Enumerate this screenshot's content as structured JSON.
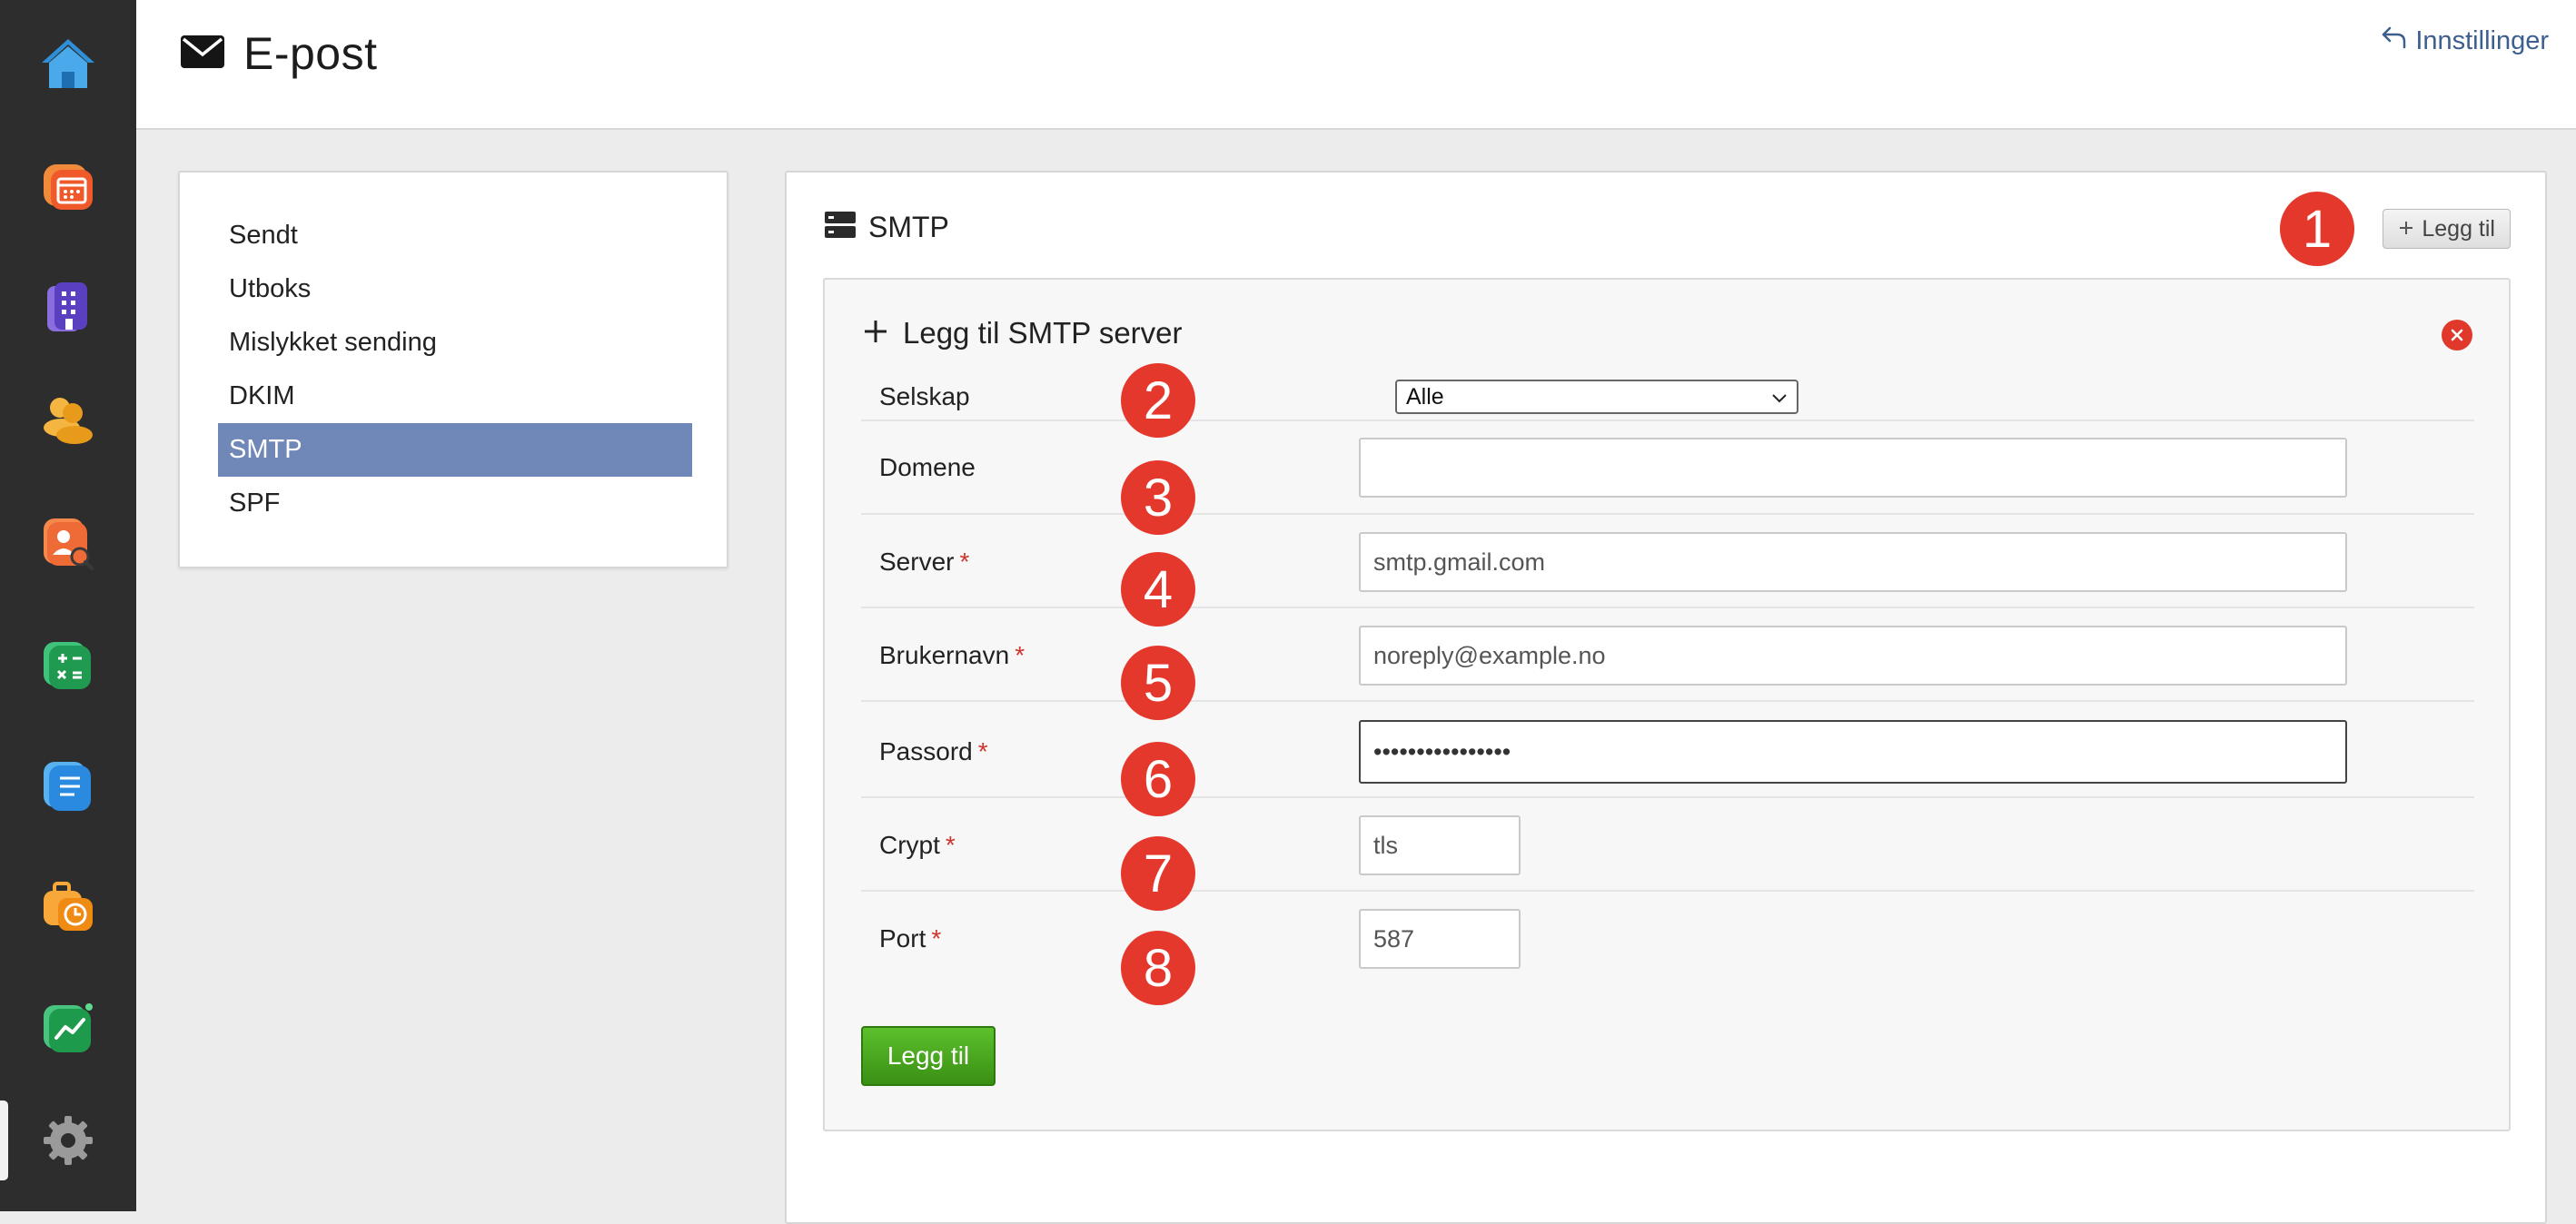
{
  "rail": {
    "items": [
      {
        "icon": "home-icon",
        "color": "#2e8fd8"
      },
      {
        "icon": "calendar-icon",
        "color": "#f07a2a"
      },
      {
        "icon": "building-icon",
        "color": "#6b4fc8"
      },
      {
        "icon": "people-icon",
        "color": "#f0a830"
      },
      {
        "icon": "person-search-icon",
        "color": "#f0703a"
      },
      {
        "icon": "calculator-icon",
        "color": "#22a050"
      },
      {
        "icon": "document-icon",
        "color": "#2f8fe0"
      },
      {
        "icon": "briefcase-clock-icon",
        "color": "#f0901c"
      },
      {
        "icon": "chart-icon",
        "color": "#22a050"
      },
      {
        "icon": "gear-icon",
        "color": "#9a9a9a"
      }
    ]
  },
  "header": {
    "title": "E-post",
    "settings_link": "Innstillinger"
  },
  "sidebar": {
    "items": [
      {
        "label": "Sendt",
        "active": false
      },
      {
        "label": "Utboks",
        "active": false
      },
      {
        "label": "Mislykket sending",
        "active": false
      },
      {
        "label": "DKIM",
        "active": false
      },
      {
        "label": "SMTP",
        "active": true
      },
      {
        "label": "SPF",
        "active": false
      }
    ]
  },
  "main": {
    "title": "SMTP",
    "add_button": "Legg til"
  },
  "form": {
    "title": "Legg til SMTP server",
    "submit_label": "Legg til",
    "fields": {
      "company": {
        "label": "Selskap",
        "value": "Alle",
        "required": false
      },
      "domain": {
        "label": "Domene",
        "value": "",
        "required": false
      },
      "server": {
        "label": "Server",
        "value": "smtp.gmail.com",
        "required": true
      },
      "username": {
        "label": "Brukernavn",
        "value": "noreply@example.no",
        "required": true
      },
      "password": {
        "label": "Passord",
        "value": "••••••••••••••••",
        "required": true
      },
      "crypt": {
        "label": "Crypt",
        "value": "tls",
        "required": true
      },
      "port": {
        "label": "Port",
        "value": "587",
        "required": true
      }
    },
    "required_mark": "*"
  },
  "markers": [
    "1",
    "2",
    "3",
    "4",
    "5",
    "6",
    "7",
    "8"
  ],
  "colors": {
    "active_nav": "#7088b8",
    "marker": "#e5382c",
    "submit": "#4aa81f",
    "link": "#3d5f8f",
    "required": "#d0342c"
  }
}
